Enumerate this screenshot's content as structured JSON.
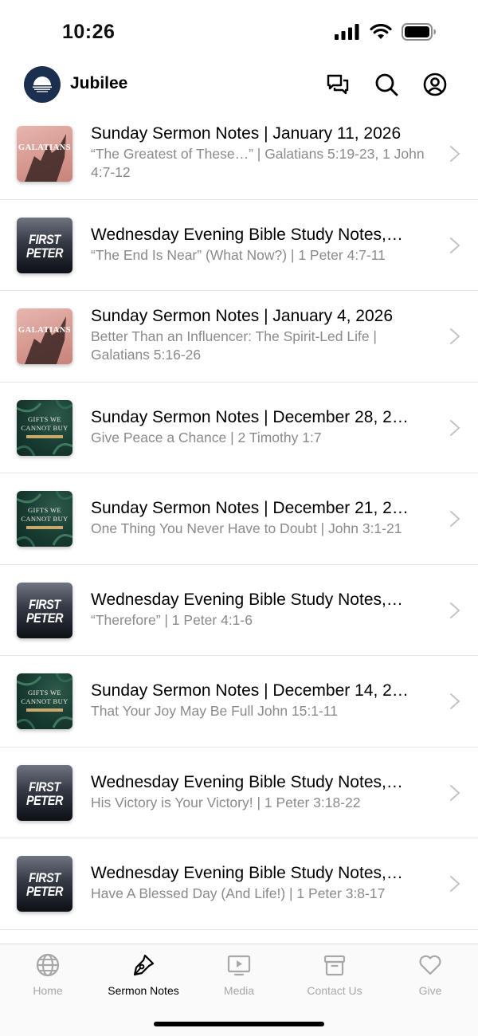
{
  "status_bar": {
    "time": "10:26"
  },
  "header": {
    "title": "Jubilee"
  },
  "items": [
    {
      "title": "Sunday Sermon Notes | January 11, 2026",
      "subtitle": "“The Greatest of These…” | Galatians 5:19-23,  1 John 4:7-12",
      "thumb": "galatians",
      "thumb_text": "GALATIANS"
    },
    {
      "title": "Wednesday Evening Bible Study Notes,…",
      "subtitle": "“The End Is Near” (What Now?) | 1 Peter 4:7-11",
      "thumb": "peter",
      "thumb_text": [
        "FIRST",
        "PETER"
      ]
    },
    {
      "title": "Sunday Sermon Notes | January 4, 2026",
      "subtitle": "Better Than an Influencer: The Spirit-Led Life | Galatians 5:16-26",
      "thumb": "galatians",
      "thumb_text": "GALATIANS"
    },
    {
      "title": "Sunday Sermon Notes | December 28, 2…",
      "subtitle": "Give Peace a Chance | 2 Timothy 1:7",
      "thumb": "gifts",
      "thumb_text": [
        "GIFTS WE",
        "CANNOT BUY"
      ]
    },
    {
      "title": "Sunday Sermon Notes | December 21, 2…",
      "subtitle": "One Thing You Never Have to Doubt | John 3:1-21",
      "thumb": "gifts",
      "thumb_text": [
        "GIFTS WE",
        "CANNOT BUY"
      ]
    },
    {
      "title": "Wednesday Evening Bible Study Notes,…",
      "subtitle": "“Therefore” | 1 Peter 4:1-6",
      "thumb": "peter",
      "thumb_text": [
        "FIRST",
        "PETER"
      ]
    },
    {
      "title": "Sunday Sermon Notes | December 14, 2…",
      "subtitle": "That Your Joy May Be Full John 15:1-11",
      "thumb": "gifts",
      "thumb_text": [
        "GIFTS WE",
        "CANNOT BUY"
      ]
    },
    {
      "title": "Wednesday Evening Bible Study Notes,…",
      "subtitle": "His Victory is Your Victory! | 1 Peter 3:18-22",
      "thumb": "peter",
      "thumb_text": [
        "FIRST",
        "PETER"
      ]
    },
    {
      "title": "Wednesday Evening Bible Study Notes,…",
      "subtitle": "Have A Blessed Day (And Life!) | 1 Peter 3:8-17",
      "thumb": "peter",
      "thumb_text": [
        "FIRST",
        "PETER"
      ]
    }
  ],
  "tabs": [
    {
      "label": "Home",
      "icon": "globe-icon",
      "active": false
    },
    {
      "label": "Sermon Notes",
      "icon": "pen-nib-icon",
      "active": true
    },
    {
      "label": "Media",
      "icon": "video-play-icon",
      "active": false
    },
    {
      "label": "Contact Us",
      "icon": "archive-box-icon",
      "active": false
    },
    {
      "label": "Give",
      "icon": "heart-icon",
      "active": false
    }
  ],
  "colors": {
    "logo_bg": "#1b2f4f",
    "subtitle_text": "#8a8a8a",
    "tab_inactive": "#a8a8a8",
    "tab_active": "#000000"
  }
}
